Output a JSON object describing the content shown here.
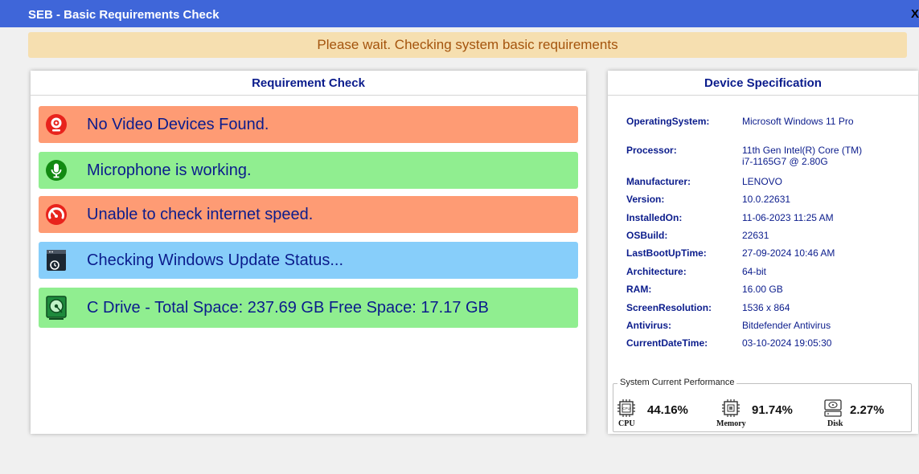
{
  "window": {
    "title": "SEB - Basic Requirements Check",
    "close_label": "X"
  },
  "banner": {
    "text": "Please wait. Checking system basic requirements",
    "color": "#f6dfb0"
  },
  "requirement_panel": {
    "title": "Requirement Check",
    "checks": [
      {
        "icon": "webcam-icon",
        "status": "error",
        "color": "#fe9b74",
        "text": "No Video Devices Found."
      },
      {
        "icon": "microphone-icon",
        "status": "ok",
        "color": "#90ee90",
        "text": "Microphone is working."
      },
      {
        "icon": "speedometer-icon",
        "status": "error",
        "color": "#fe9b74",
        "text": "Unable to check internet speed."
      },
      {
        "icon": "windows-update-icon",
        "status": "pending",
        "color": "#87cefa",
        "text": "Checking Windows Update Status..."
      },
      {
        "icon": "disk-drive-icon",
        "status": "ok",
        "color": "#90ee90",
        "text": "C Drive - Total Space: 237.69 GB Free Space: 17.17 GB"
      }
    ]
  },
  "device_panel": {
    "title": "Device Specification",
    "specs": [
      {
        "key": "OperatingSystem:",
        "value": "Microsoft Windows 11 Pro"
      },
      {
        "key": "Processor:",
        "value": "11th Gen Intel(R) Core (TM) i7-1165G7 @ 2.80G"
      },
      {
        "key": "Manufacturer:",
        "value": "LENOVO"
      },
      {
        "key": "Version:",
        "value": "10.0.22631"
      },
      {
        "key": "InstalledOn:",
        "value": "11-06-2023 11:25 AM"
      },
      {
        "key": "OSBuild:",
        "value": "22631"
      },
      {
        "key": "LastBootUpTime:",
        "value": "27-09-2024 10:46 AM"
      },
      {
        "key": "Architecture:",
        "value": "64-bit"
      },
      {
        "key": "RAM:",
        "value": "16.00 GB"
      },
      {
        "key": "ScreenResolution:",
        "value": "1536 x 864"
      },
      {
        "key": "Antivirus:",
        "value": "Bitdefender Antivirus"
      },
      {
        "key": "CurrentDateTime:",
        "value": "03-10-2024 19:05:30"
      }
    ],
    "performance": {
      "legend": "System Current Performance",
      "cpu": {
        "icon": "cpu-icon",
        "label": "CPU",
        "value": "44.16%"
      },
      "memory": {
        "icon": "memory-chip-icon",
        "label": "Memory",
        "value": "91.74%"
      },
      "disk": {
        "icon": "hard-disk-icon",
        "label": "Disk",
        "value": "2.27%"
      }
    }
  }
}
